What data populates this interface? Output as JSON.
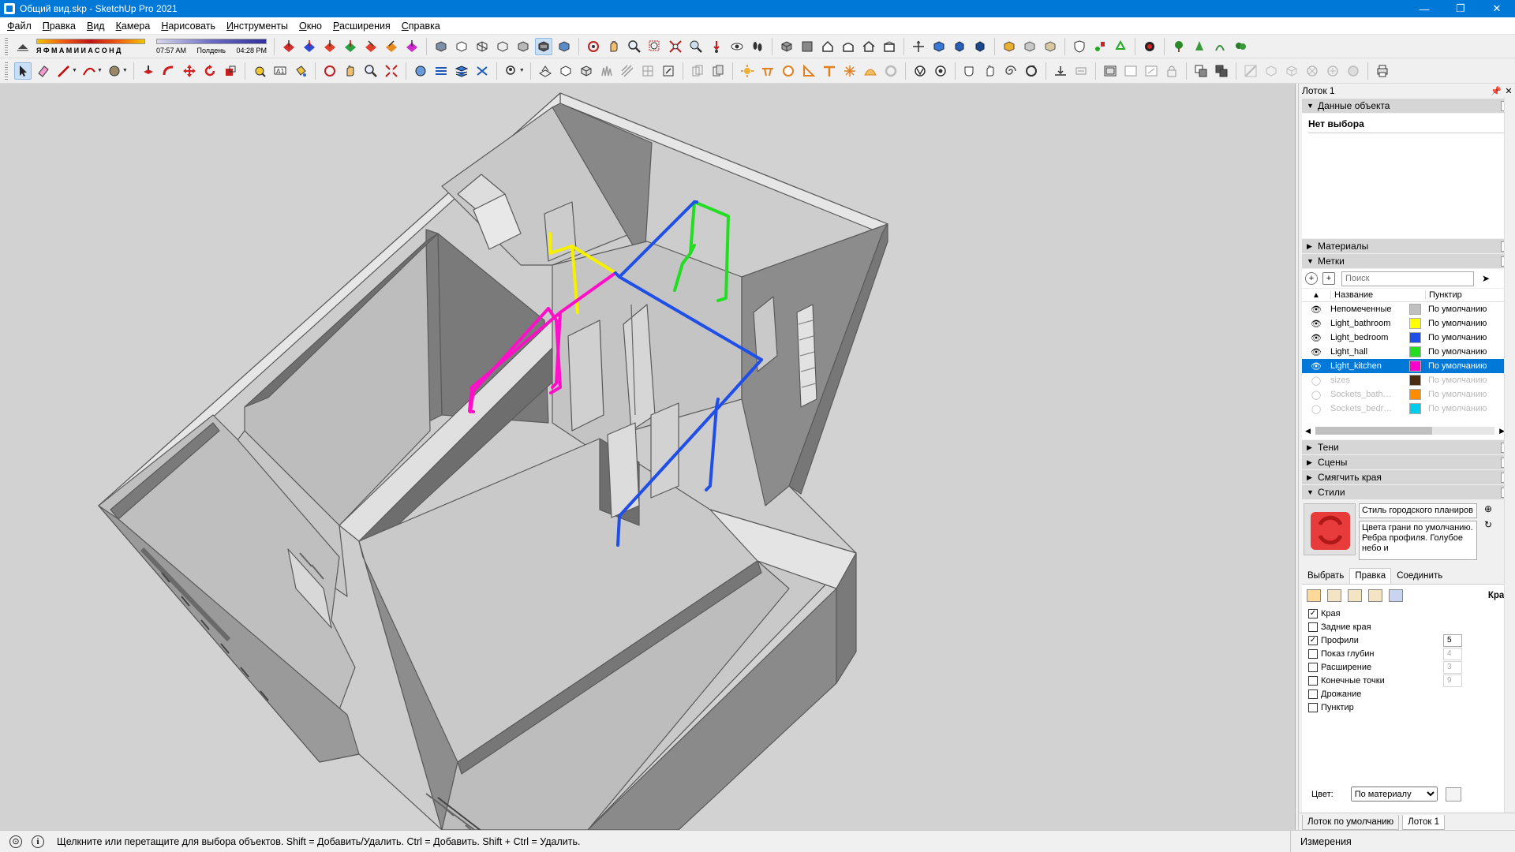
{
  "window": {
    "title": "Общий вид.skp - SketchUp Pro 2021",
    "minimize": "—",
    "maximize": "❐",
    "close": "✕"
  },
  "menu": [
    "Файл",
    "Правка",
    "Вид",
    "Камера",
    "Нарисовать",
    "Инструменты",
    "Окно",
    "Расширения",
    "Справка"
  ],
  "shadows": {
    "month_letters": "ЯФМАМИИАСОНД",
    "time_start": "07:57 AM",
    "time_mid": "Полдень",
    "time_end": "04:28 PM"
  },
  "tray": {
    "title": "Лоток 1",
    "entity_info": {
      "header": "Данные объекта",
      "body": "Нет выбора"
    },
    "materials_header": "Материалы",
    "tags": {
      "header": "Метки",
      "search_placeholder": "Поиск",
      "col_name": "Название",
      "col_dash": "Пунктир",
      "rows": [
        {
          "name": "Непомеченные",
          "color": "#c0c0c0",
          "dash": "По умолчанию",
          "visible": true
        },
        {
          "name": "Light_bathroom",
          "color": "#ffff00",
          "dash": "По умолчанию",
          "visible": true
        },
        {
          "name": "Light_bedroom",
          "color": "#1f4fe6",
          "dash": "По умолчанию",
          "visible": true
        },
        {
          "name": "Light_hall",
          "color": "#22dd22",
          "dash": "По умолчанию",
          "visible": true
        },
        {
          "name": "Light_kitchen",
          "color": "#ff00cc",
          "dash": "По умолчанию",
          "visible": true,
          "selected": true
        },
        {
          "name": "sizes",
          "color": "#4a2c10",
          "dash": "По умолчанию",
          "visible": false
        },
        {
          "name": "Sockets_bath…",
          "color": "#ff8c00",
          "dash": "По умолчанию",
          "visible": false
        },
        {
          "name": "Sockets_bedr…",
          "color": "#00ccee",
          "dash": "По умолчанию",
          "visible": false
        }
      ]
    },
    "shadows_header": "Тени",
    "scenes_header": "Сцены",
    "soften_header": "Смягчить края",
    "styles": {
      "header": "Стили",
      "style_name": "Стиль городского планиров",
      "style_desc": "Цвета грани по умолчанию. Ребра профиля. Голубое небо и",
      "tabs": [
        "Выбрать",
        "Правка",
        "Соединить"
      ],
      "edit_label": "Края",
      "options": [
        {
          "label": "Края",
          "checked": true,
          "value": ""
        },
        {
          "label": "Задние края",
          "checked": false,
          "value": ""
        },
        {
          "label": "Профили",
          "checked": true,
          "value": "5"
        },
        {
          "label": "Показ глубин",
          "checked": false,
          "value": "4"
        },
        {
          "label": "Расширение",
          "checked": false,
          "value": "3"
        },
        {
          "label": "Конечные точки",
          "checked": false,
          "value": "9"
        },
        {
          "label": "Дрожание",
          "checked": false,
          "value": ""
        },
        {
          "label": "Пунктир",
          "checked": false,
          "value": ""
        }
      ],
      "color_label": "Цвет:",
      "color_value": "По материалу"
    },
    "bottom_tabs": [
      "Лоток по умолчанию",
      "Лоток 1"
    ]
  },
  "status": {
    "message": "Щелкните или перетащите для выбора объектов. Shift = Добавить/Удалить. Ctrl = Добавить. Shift + Ctrl = Удалить.",
    "measurements_label": "Измерения"
  },
  "colors": {
    "bathroom": "#f5f000",
    "bedroom": "#1f4fe6",
    "hall": "#22dd22",
    "kitchen": "#ff10c8",
    "selection": "#0078d7"
  }
}
